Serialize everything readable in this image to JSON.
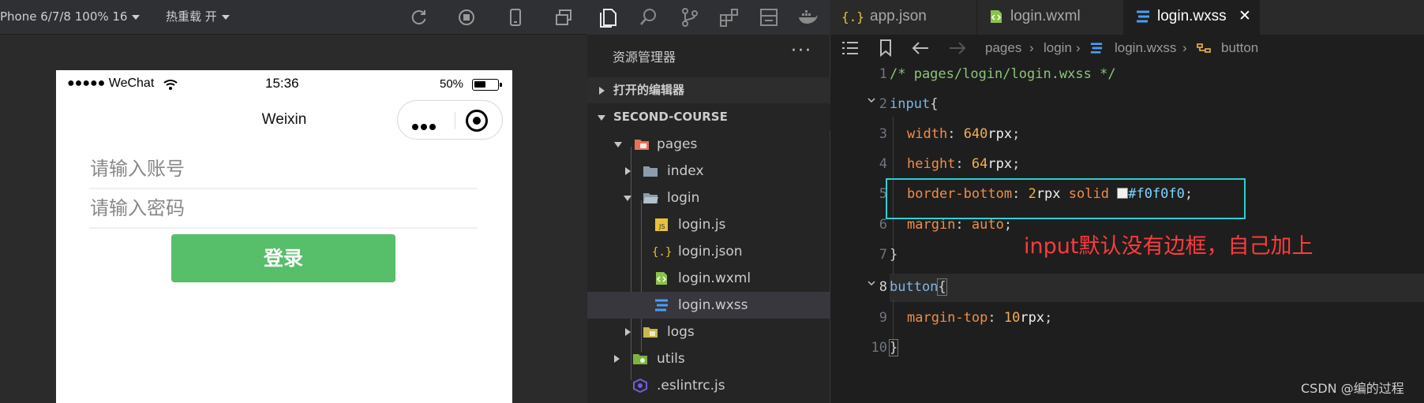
{
  "simulator": {
    "device_label": "Phone 6/7/8 100% 16",
    "hot_reload_label": "热重载 开",
    "status_bar": {
      "carrier": "●●●●● WeChat",
      "time": "15:36",
      "battery": "50%"
    },
    "nav_title": "Weixin",
    "account_placeholder": "请输入账号",
    "password_placeholder": "请输入密码",
    "login_button": "登录"
  },
  "explorer": {
    "title": "资源管理器",
    "more": "···",
    "open_editors": "打开的编辑器",
    "project": "SECOND-COURSE",
    "tree": [
      {
        "label": "pages"
      },
      {
        "label": "index"
      },
      {
        "label": "login"
      },
      {
        "label": "login.js"
      },
      {
        "label": "login.json"
      },
      {
        "label": "login.wxml"
      },
      {
        "label": "login.wxss"
      },
      {
        "label": "logs"
      },
      {
        "label": "utils"
      },
      {
        "label": ".eslintrc.js"
      }
    ]
  },
  "editor": {
    "tabs": [
      {
        "label": "app.json",
        "icon": "json-braces-icon"
      },
      {
        "label": "login.wxml",
        "icon": "wxml-file-icon"
      },
      {
        "label": "login.wxss",
        "icon": "css-file-icon",
        "close": "✕"
      }
    ],
    "breadcrumb": {
      "p1": "pages",
      "p2": "login",
      "p3": "login.wxss",
      "p4": "button",
      "sep": "›"
    },
    "line_numbers": [
      "1",
      "2",
      "3",
      "4",
      "5",
      "6",
      "7",
      "8",
      "9",
      "10"
    ],
    "code": {
      "l1": "/* pages/login/login.wxss */",
      "l2_sel": "input",
      "l2_brace": "{",
      "l3_prop": "width",
      "l3_num": "640",
      "l3_unit": "rpx",
      "l4_prop": "height",
      "l4_num": "64",
      "l4_unit": "rpx",
      "l5_prop": "border-bottom",
      "l5_num": "2",
      "l5_unit": "rpx",
      "l5_kw": "solid",
      "l5_hex": "#f0f0f0",
      "l6_prop": "margin",
      "l6_kw": "auto",
      "l7": "}",
      "l8_sel": "button",
      "l8_brace": "{",
      "l9_prop": "margin-top",
      "l9_num": "10",
      "l9_unit": "rpx",
      "l10": "}",
      "colon": ":",
      "semi": ";"
    },
    "annotation": "input默认没有边框，自己加上",
    "swatch_color": "#f0f0f0"
  },
  "watermark": "CSDN @编的过程"
}
